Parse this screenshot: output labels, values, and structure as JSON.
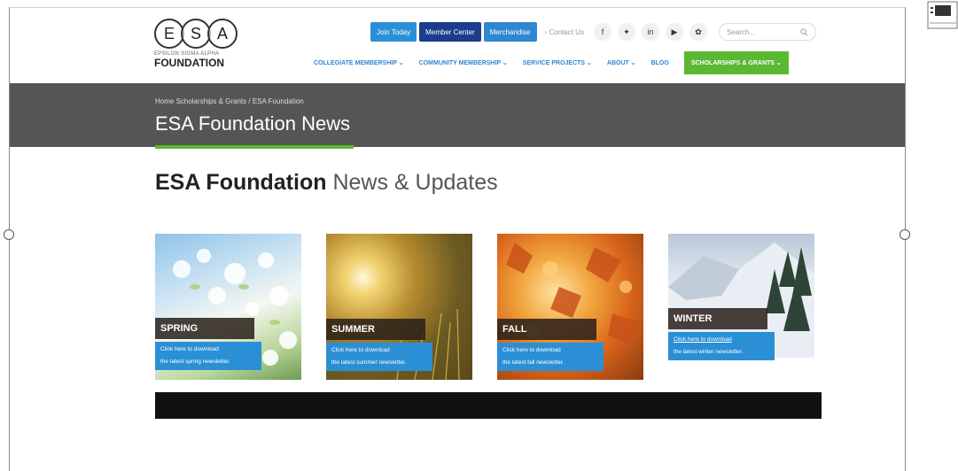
{
  "logo": {
    "letters": [
      "E",
      "S",
      "A"
    ],
    "sub": "EPSILON SIGMA ALPHA",
    "main": "FOUNDATION"
  },
  "topbar": {
    "buttons": [
      "Join Today",
      "Member Center",
      "Merchandise"
    ],
    "contact": "› Contact Us",
    "social": [
      "f",
      "✦",
      "in",
      "▶",
      "✿"
    ],
    "search_placeholder": "Search..."
  },
  "nav": [
    "COLLEGIATE MEMBERSHIP ⌄",
    "COMMUNITY MEMBERSHIP ⌄",
    "SERVICE PROJECTS ⌄",
    "ABOUT ⌄",
    "BLOG",
    "SCHOLARSHIPS & GRANTS ⌄"
  ],
  "banner": {
    "breadcrumb": "Home Scholarships & Grants / ESA Foundation",
    "title": "ESA Foundation News"
  },
  "section": {
    "bold": "ESA Foundation",
    "rest": "News & Updates"
  },
  "cards": [
    {
      "season": "SPRING",
      "link1": "Click here to download",
      "link2": "the latest spring newsletter."
    },
    {
      "season": "SUMMER",
      "link1": "Click here to download",
      "link2": "the latest summer newsletter."
    },
    {
      "season": "FALL",
      "link1": "Click here to download",
      "link2": "the latest fall newsletter."
    },
    {
      "season": "WINTER",
      "link1": "Click here to download",
      "link2": "the latest winter newsletter."
    }
  ],
  "colors": {
    "accent_green": "#5ab833",
    "accent_blue": "#2b8fd6",
    "navy": "#1a3d8c",
    "banner": "#555555"
  }
}
